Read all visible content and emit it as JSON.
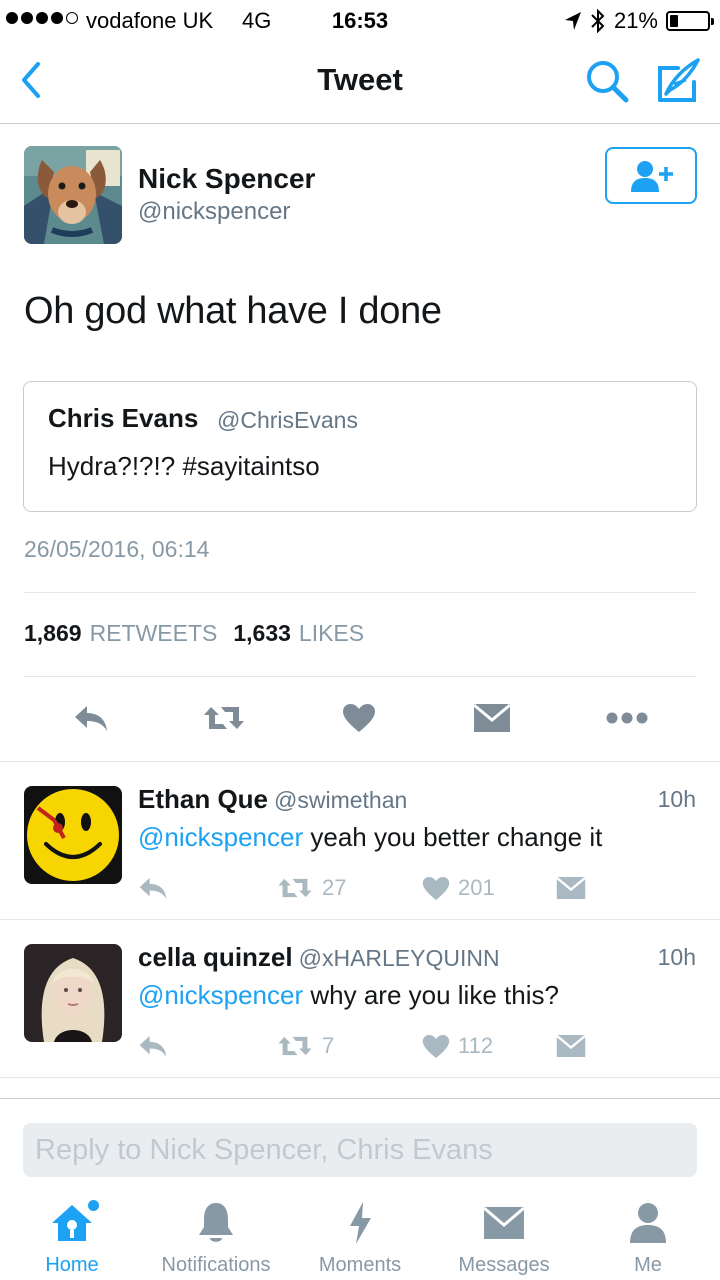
{
  "status_bar": {
    "carrier": "vodafone UK",
    "network": "4G",
    "time": "16:53",
    "battery": "21%",
    "battery_level": 0.21,
    "icons": [
      "signal-dots-icon",
      "location-arrow-icon",
      "bluetooth-icon",
      "battery-icon"
    ]
  },
  "nav": {
    "title": "Tweet",
    "back_icon": "chevron-left-icon",
    "search_icon": "search-icon",
    "compose_icon": "compose-icon"
  },
  "tweet": {
    "author_name": "Nick Spencer",
    "author_handle": "@nickspencer",
    "text": "Oh god what have I done",
    "quote": {
      "name": "Chris Evans",
      "handle": "@ChrisEvans",
      "text": "Hydra?!?!? #sayitaintso"
    },
    "timestamp": "26/05/2016, 06:14",
    "retweets_count": "1,869",
    "retweets_label": "RETWEETS",
    "likes_count": "1,633",
    "likes_label": "LIKES"
  },
  "replies": [
    {
      "name": "Ethan Que",
      "handle": "@swimethan",
      "time": "10h",
      "mention": "@nickspencer",
      "text": " yeah you better change it",
      "retweets": "27",
      "likes": "201"
    },
    {
      "name": "cella quinzel",
      "handle": "@xHARLEYQUINN",
      "time": "10h",
      "mention": "@nickspencer",
      "text": " why are you like this?",
      "retweets": "7",
      "likes": "112"
    }
  ],
  "composer": {
    "placeholder": "Reply to Nick Spencer, Chris Evans"
  },
  "tabs": [
    {
      "label": "Home",
      "icon": "home-icon",
      "active": true
    },
    {
      "label": "Notifications",
      "icon": "bell-icon",
      "active": false
    },
    {
      "label": "Moments",
      "icon": "lightning-icon",
      "active": false
    },
    {
      "label": "Messages",
      "icon": "envelope-icon",
      "active": false
    },
    {
      "label": "Me",
      "icon": "person-icon",
      "active": false
    }
  ],
  "colors": {
    "accent": "#1da1f2",
    "text": "#14171a",
    "secondary": "#657786",
    "muted": "#8899a6",
    "action_gray": "#aab8c2"
  }
}
